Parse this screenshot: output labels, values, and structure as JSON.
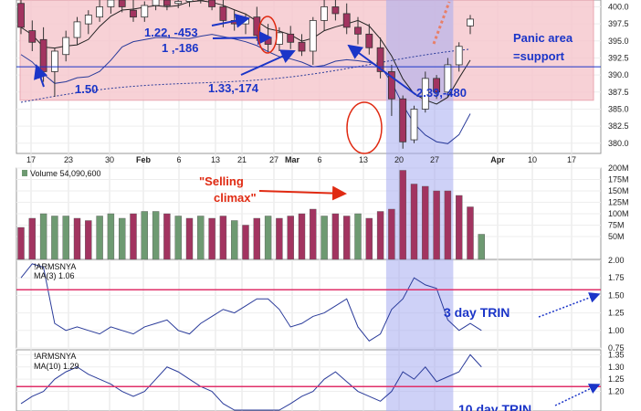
{
  "chart_data": {
    "type": "candlestick",
    "x_tick_labels": [
      "17",
      "23",
      "30",
      "Feb",
      "6",
      "13",
      "21",
      "27",
      "Mar",
      "6",
      "13",
      "20",
      "27",
      "Apr",
      "10",
      "17"
    ],
    "price": {
      "ylim": [
        378.5,
        401
      ],
      "y_ticks": [
        "400.0",
        "397.5",
        "395.0",
        "392.5",
        "390.0",
        "387.5",
        "385.0",
        "382.5",
        "380.0"
      ],
      "support_level": 391.2,
      "panic_area": [
        386.3,
        401
      ]
    },
    "candles": [
      {
        "o": 400.5,
        "h": 401.8,
        "l": 396.0,
        "c": 397.0
      },
      {
        "o": 396.5,
        "h": 398.0,
        "l": 393.5,
        "c": 394.8
      },
      {
        "o": 395.2,
        "h": 397.0,
        "l": 389.0,
        "c": 390.5
      },
      {
        "o": 390.5,
        "h": 394.0,
        "l": 386.8,
        "c": 393.5
      },
      {
        "o": 393.0,
        "h": 396.5,
        "l": 392.0,
        "c": 395.5
      },
      {
        "o": 395.5,
        "h": 398.5,
        "l": 394.5,
        "c": 397.8
      },
      {
        "o": 397.5,
        "h": 399.5,
        "l": 396.0,
        "c": 398.8
      },
      {
        "o": 398.5,
        "h": 401.5,
        "l": 397.8,
        "c": 400.0
      },
      {
        "o": 400.0,
        "h": 401.8,
        "l": 399.0,
        "c": 401.0
      },
      {
        "o": 401.0,
        "h": 402.0,
        "l": 399.2,
        "c": 400.0
      },
      {
        "o": 399.5,
        "h": 401.0,
        "l": 397.8,
        "c": 398.5
      },
      {
        "o": 398.5,
        "h": 400.8,
        "l": 397.8,
        "c": 400.2
      },
      {
        "o": 400.2,
        "h": 401.8,
        "l": 399.5,
        "c": 401.2
      },
      {
        "o": 401.0,
        "h": 401.8,
        "l": 399.5,
        "c": 400.2
      },
      {
        "o": 400.5,
        "h": 401.5,
        "l": 399.8,
        "c": 400.8
      },
      {
        "o": 400.8,
        "h": 401.7,
        "l": 400.0,
        "c": 401.3
      },
      {
        "o": 401.3,
        "h": 401.8,
        "l": 400.5,
        "c": 401.0
      },
      {
        "o": 401.0,
        "h": 401.8,
        "l": 399.5,
        "c": 400.0
      },
      {
        "o": 400.0,
        "h": 401.2,
        "l": 397.0,
        "c": 398.0
      },
      {
        "o": 398.0,
        "h": 399.5,
        "l": 396.5,
        "c": 397.5
      },
      {
        "o": 397.5,
        "h": 399.0,
        "l": 396.0,
        "c": 398.2
      },
      {
        "o": 398.5,
        "h": 400.0,
        "l": 395.0,
        "c": 395.8
      },
      {
        "o": 395.5,
        "h": 397.5,
        "l": 393.5,
        "c": 394.5
      },
      {
        "o": 394.5,
        "h": 397.0,
        "l": 393.5,
        "c": 396.2
      },
      {
        "o": 396.0,
        "h": 397.2,
        "l": 393.8,
        "c": 394.8
      },
      {
        "o": 394.8,
        "h": 396.0,
        "l": 392.8,
        "c": 393.5
      },
      {
        "o": 393.5,
        "h": 398.5,
        "l": 391.5,
        "c": 398.0
      },
      {
        "o": 398.0,
        "h": 401.0,
        "l": 396.5,
        "c": 400.0
      },
      {
        "o": 400.0,
        "h": 401.8,
        "l": 398.0,
        "c": 399.0
      },
      {
        "o": 399.0,
        "h": 400.5,
        "l": 396.0,
        "c": 397.0
      },
      {
        "o": 397.0,
        "h": 398.5,
        "l": 394.5,
        "c": 396.0
      },
      {
        "o": 396.0,
        "h": 397.5,
        "l": 393.0,
        "c": 394.0
      },
      {
        "o": 394.0,
        "h": 395.5,
        "l": 389.5,
        "c": 390.5
      },
      {
        "o": 390.5,
        "h": 391.5,
        "l": 384.0,
        "c": 386.5
      },
      {
        "o": 386.5,
        "h": 387.0,
        "l": 379.2,
        "c": 380.2
      },
      {
        "o": 380.5,
        "h": 385.5,
        "l": 380.0,
        "c": 385.0
      },
      {
        "o": 385.0,
        "h": 390.5,
        "l": 384.5,
        "c": 389.5
      },
      {
        "o": 389.5,
        "h": 390.0,
        "l": 386.5,
        "c": 387.5
      },
      {
        "o": 387.5,
        "h": 392.5,
        "l": 386.8,
        "c": 391.5
      },
      {
        "o": 391.5,
        "h": 394.8,
        "l": 390.5,
        "c": 394.2
      },
      {
        "o": 397.2,
        "h": 398.8,
        "l": 396.0,
        "c": 398.2
      }
    ],
    "highlight_index_range": [
      33,
      38
    ],
    "volume_label": "Volume 54,090,600",
    "volume": {
      "ylim": [
        0,
        200
      ],
      "y_ticks": [
        "200M",
        "175M",
        "150M",
        "125M",
        "100M",
        "75M",
        "50M"
      ],
      "values": [
        70,
        90,
        100,
        95,
        95,
        90,
        85,
        95,
        100,
        90,
        100,
        105,
        105,
        100,
        95,
        90,
        95,
        90,
        95,
        85,
        75,
        90,
        95,
        90,
        95,
        100,
        110,
        95,
        100,
        95,
        100,
        90,
        105,
        110,
        195,
        165,
        160,
        150,
        150,
        140,
        115,
        55
      ],
      "colors_up_down": [
        "d",
        "d",
        "u",
        "u",
        "u",
        "d",
        "d",
        "u",
        "u",
        "u",
        "d",
        "u",
        "u",
        "d",
        "u",
        "d",
        "u",
        "d",
        "d",
        "u",
        "d",
        "d",
        "u",
        "d",
        "d",
        "d",
        "d",
        "u",
        "d",
        "d",
        "u",
        "d",
        "d",
        "d",
        "d",
        "d",
        "d",
        "d",
        "d",
        "d",
        "d",
        "u"
      ]
    },
    "trin3": {
      "symbol": "!ARMSNYA",
      "legend": "MA(3) 1.06",
      "ylim": [
        0.75,
        2.0
      ],
      "y_ticks": [
        "2.00",
        "1.75",
        "1.50",
        "1.25",
        "1.00",
        "0.75"
      ],
      "reference": 1.58,
      "values": [
        1.75,
        1.95,
        1.9,
        1.1,
        1.0,
        1.05,
        1.0,
        0.95,
        1.05,
        1.0,
        0.95,
        1.05,
        1.1,
        1.15,
        1.0,
        0.95,
        1.1,
        1.2,
        1.3,
        1.25,
        1.35,
        1.45,
        1.45,
        1.3,
        1.05,
        1.1,
        1.2,
        1.25,
        1.35,
        1.45,
        1.05,
        0.85,
        0.95,
        1.3,
        1.45,
        1.75,
        1.65,
        1.6,
        1.15,
        1.0,
        1.1,
        1.0
      ]
    },
    "trin10": {
      "symbol": "!ARMSNYA",
      "legend": "MA(10) 1.29",
      "ylim": [
        1.12,
        1.37
      ],
      "y_ticks": [
        "1.35",
        "1.30",
        "1.25",
        "1.20"
      ],
      "reference": 1.22,
      "values": [
        1.15,
        1.18,
        1.2,
        1.25,
        1.28,
        1.3,
        1.27,
        1.25,
        1.23,
        1.2,
        1.18,
        1.2,
        1.25,
        1.3,
        1.28,
        1.25,
        1.22,
        1.2,
        1.15,
        1.12,
        1.1,
        1.08,
        1.1,
        1.12,
        1.15,
        1.18,
        1.2,
        1.25,
        1.28,
        1.24,
        1.2,
        1.18,
        1.16,
        1.2,
        1.28,
        1.25,
        1.3,
        1.24,
        1.26,
        1.28,
        1.35,
        1.3
      ]
    },
    "annotations": {
      "a1": "1.22, -453",
      "a2": "1 ,-186",
      "a3": "1.33,-174",
      "a4": "1.50",
      "a5": "2.39,-480",
      "panic1": "Panic area",
      "panic2": "=support",
      "climax1": "\"Selling",
      "climax2": "climax\"",
      "trin3": "3 day TRIN",
      "trin10": "10 day TRIN"
    },
    "colors": {
      "up": "#6e9a72",
      "down": "#a23460",
      "panic": "#f6c9cf",
      "highlight": "#a6abf0",
      "annotation": "#1b35c8",
      "reference": "#e0306a"
    }
  }
}
